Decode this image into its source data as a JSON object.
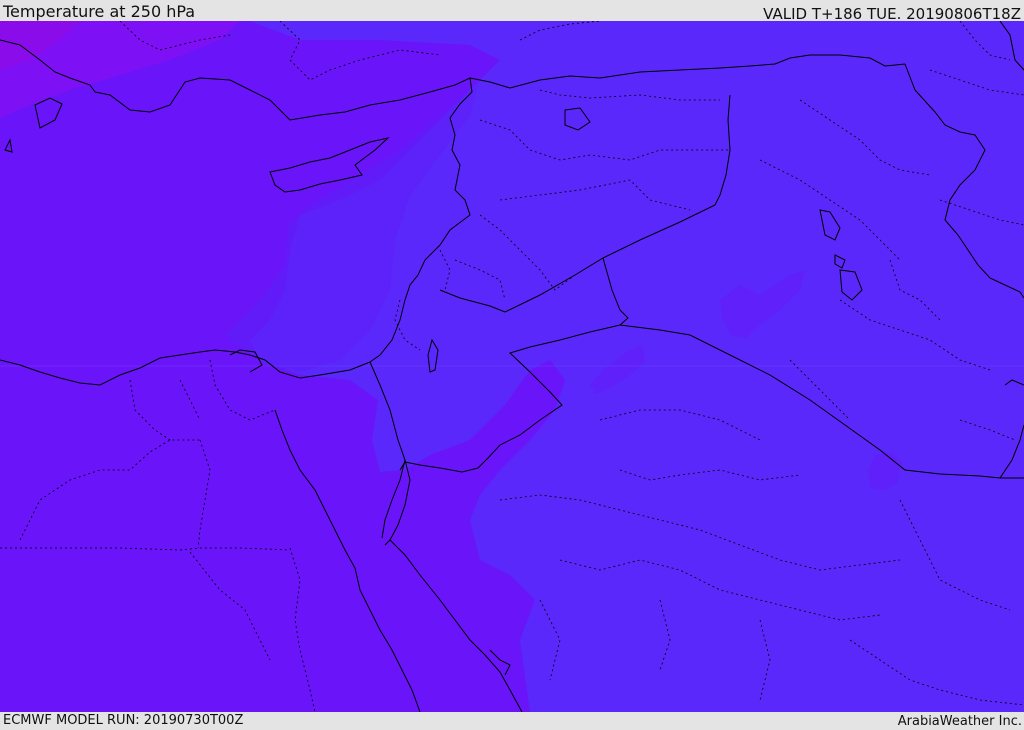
{
  "header": {
    "title": "Temperature at 250 hPa",
    "valid": "VALID T+186 TUE. 20190806T18Z"
  },
  "footer": {
    "model_run": "ECMWF MODEL RUN: 20190730T00Z",
    "credit": "ArabiaWeather Inc."
  },
  "colors": {
    "background_bar": "#e4e4e4",
    "field_cold": "#6a14fa",
    "field_mid": "#5a24fa",
    "field_warm": "#5632fa",
    "field_coldest": "#8a0cf0",
    "boundary": "#000000"
  },
  "icons": []
}
